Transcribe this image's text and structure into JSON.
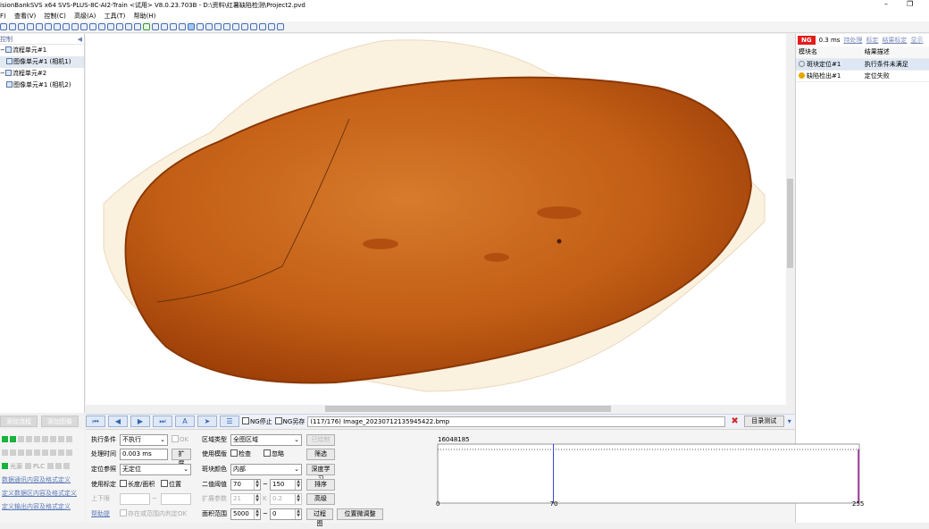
{
  "window": {
    "title": "isionBankSVS x64 SVS-PLUS-8C-AI2-Train <试用> V8.0.23.703B - D:\\资料\\红薯缺陷检测\\Project2.pvd",
    "minimize": "–",
    "restore": "❐"
  },
  "menu": [
    "F)",
    "查看(V)",
    "控制(C)",
    "高级(A)",
    "工具(T)",
    "帮助(H)"
  ],
  "left_panel": {
    "header": "控制",
    "collapse_glyph": "◀",
    "tree": [
      {
        "label": "流程单元#1",
        "prefix": "−",
        "level": 0
      },
      {
        "label": "图像单元#1 (相机1)",
        "prefix": "",
        "level": 1,
        "selected": true
      },
      {
        "label": "流程单元#2",
        "prefix": "−",
        "level": 0
      },
      {
        "label": "图像单元#1 (相机2)",
        "prefix": "",
        "level": 1
      }
    ],
    "add_flow_label": "添加流程",
    "add_image_label": "添加图像",
    "light_label": "光源",
    "plc_label": "PLC",
    "links": [
      "数据通讯内容及格式定义",
      "定义数据区内容及格式定义",
      "定义输出内容及格式定义"
    ]
  },
  "right_panel": {
    "status": "NG",
    "time": "0.3 ms",
    "actions": [
      "持处理",
      "标定",
      "结果标定",
      "显示"
    ],
    "columns": [
      "模块名",
      "结果描述"
    ],
    "rows": [
      {
        "name": "斑块定位#1",
        "result": "执行条件未满足",
        "status_color": "#8a8a8a",
        "selected": true
      },
      {
        "name": "缺陷检出#1",
        "result": "定位失败",
        "status_color": "#e7a800",
        "selected": false
      }
    ]
  },
  "navbar": {
    "ng_stop": "NG停止",
    "ng_save": "NG另存",
    "image_path": "(117/176) Image_20230712135945422.bmp",
    "dir_test": "目录测试"
  },
  "params": {
    "exec_cond_label": "执行条件",
    "exec_cond_value": "不执行",
    "ok_label": "OK",
    "proc_time_label": "处理时间",
    "proc_time_value": "0.003 ms",
    "expand_label": "扩展",
    "locate_param_label": "定位参照",
    "locate_param_value": "无定位",
    "use_calib_label": "使用标定",
    "length_area_label": "长度/面积",
    "position_label": "位置",
    "upper_lower_label": "上下限",
    "tilde": "~",
    "help_link": "帮助提",
    "save_label": "存在或范围内判定OK",
    "region_type_label": "区域类型",
    "region_type_value": "全图区域",
    "draw_btn": "已绘制",
    "use_template_label": "使用模版",
    "check_label": "检查",
    "ignore_label": "忽略",
    "filter_btn": "筛选",
    "blob_color_label": "斑块颜色",
    "blob_color_value": "内部",
    "deep_learn_btn": "深度学习",
    "binary_thresh_label": "二值阈值",
    "thresh_low": "70",
    "thresh_high": "150",
    "sort_btn": "排序",
    "expand_param_label": "扩展参数",
    "expand_param_value": "21",
    "k_label": "K",
    "k_value": "0.2",
    "advanced_btn": "高级",
    "area_range_label": "面积范围",
    "area_low": "5000",
    "area_high": "0",
    "process_img_btn": "过程图",
    "pos_adjust_btn": "位置微调整"
  },
  "histogram": {
    "title": "16048185",
    "x_ticks": [
      "0",
      "70",
      "255"
    ],
    "threshold": 70,
    "x_max": 255
  },
  "colors": {
    "ng_red": "#e31b1b",
    "potato_orange": "#c8621a",
    "hist_line": "#2b3fd1",
    "led_green": "#18b33a"
  }
}
